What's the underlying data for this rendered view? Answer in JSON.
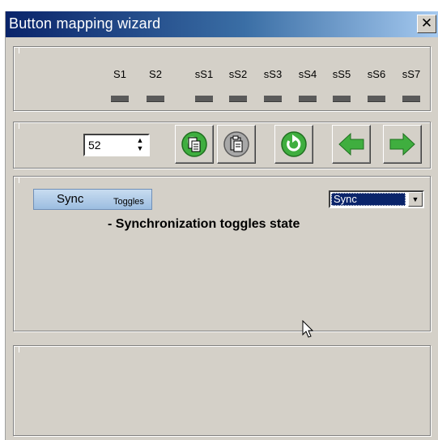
{
  "window": {
    "title": "Button mapping wizard",
    "close_label": "✕"
  },
  "leds": [
    {
      "label": "S1"
    },
    {
      "label": "S2"
    },
    {
      "label": "sS1"
    },
    {
      "label": "sS2"
    },
    {
      "label": "sS3"
    },
    {
      "label": "sS4"
    },
    {
      "label": "sS5"
    },
    {
      "label": "sS6"
    },
    {
      "label": "sS7"
    }
  ],
  "toolbar": {
    "number_value": "52",
    "spin_up": "▲",
    "spin_down": "▼",
    "icons": [
      "copy-icon",
      "paste-icon",
      "refresh-icon",
      "back-arrow-icon",
      "forward-arrow-icon"
    ]
  },
  "mapping": {
    "sync_button_main": "Sync",
    "sync_button_sub": "Toggles",
    "select_value": "Sync",
    "select_arrow": "▼",
    "description": "- Synchronization toggles state"
  },
  "colors": {
    "title_start": "#0a246a",
    "title_end": "#a6caf0",
    "face": "#d4d0c8",
    "accent_green": "#3fae3f"
  }
}
